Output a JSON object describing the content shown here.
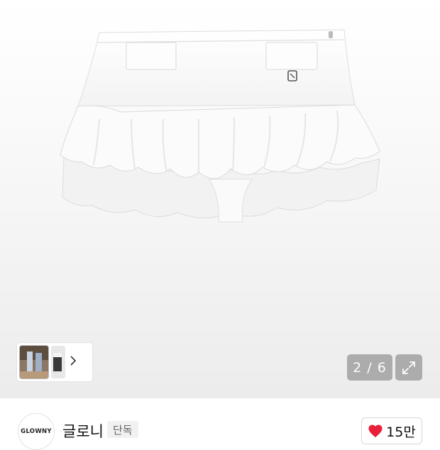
{
  "gallery": {
    "counter": "2 / 6"
  },
  "brand": {
    "logo_text": "GLOWNY",
    "name": "글로니",
    "badge": "단독"
  },
  "likes": {
    "count": "15만"
  },
  "icons": {
    "next": "chevron-right-icon",
    "expand": "expand-icon",
    "like": "heart-icon"
  },
  "colors": {
    "heart": "#e8203a",
    "counter_bg": "#a5a5a5",
    "badge_bg": "#f1f1f1"
  }
}
